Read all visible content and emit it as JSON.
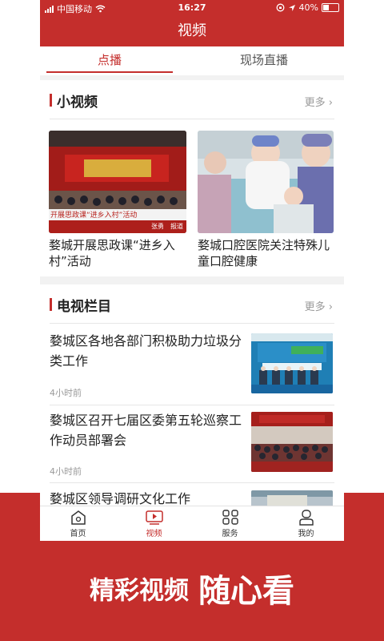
{
  "status_bar": {
    "carrier": "中国移动",
    "time": "16:27",
    "battery": "40%"
  },
  "header": {
    "title": "视频"
  },
  "tabs": [
    {
      "label": "点播"
    },
    {
      "label": "现场直播"
    }
  ],
  "short_video": {
    "title": "小视频",
    "more": "更多",
    "items": [
      {
        "caption": "婺城开展思政课“进乡入村”活动",
        "thumb_banner": "开展思政课“进乡入村”活动",
        "thumb_source": "张勇　报道"
      },
      {
        "caption": "婺城口腔医院关注特殊儿童口腔健康"
      }
    ]
  },
  "tv_columns": {
    "title": "电视栏目",
    "more": "更多",
    "items": [
      {
        "title": "婺城区各地各部门积极助力垃圾分类工作",
        "time": "4小时前"
      },
      {
        "title": "婺城区召开七届区委第五轮巡察工作动员部署会",
        "time": "4小时前"
      },
      {
        "title": "婺城区领导调研文化工作"
      }
    ]
  },
  "bottom_nav": [
    {
      "label": "首页",
      "icon": "home-icon"
    },
    {
      "label": "视频",
      "icon": "video-icon"
    },
    {
      "label": "服务",
      "icon": "grid-icon"
    },
    {
      "label": "我的",
      "icon": "user-icon"
    }
  ],
  "slogan": {
    "part1": "精彩视频",
    "part2": "随心看"
  },
  "colors": {
    "brand": "#c42e2c",
    "background": "#f2f2f2",
    "divider": "#e6e6e6"
  }
}
